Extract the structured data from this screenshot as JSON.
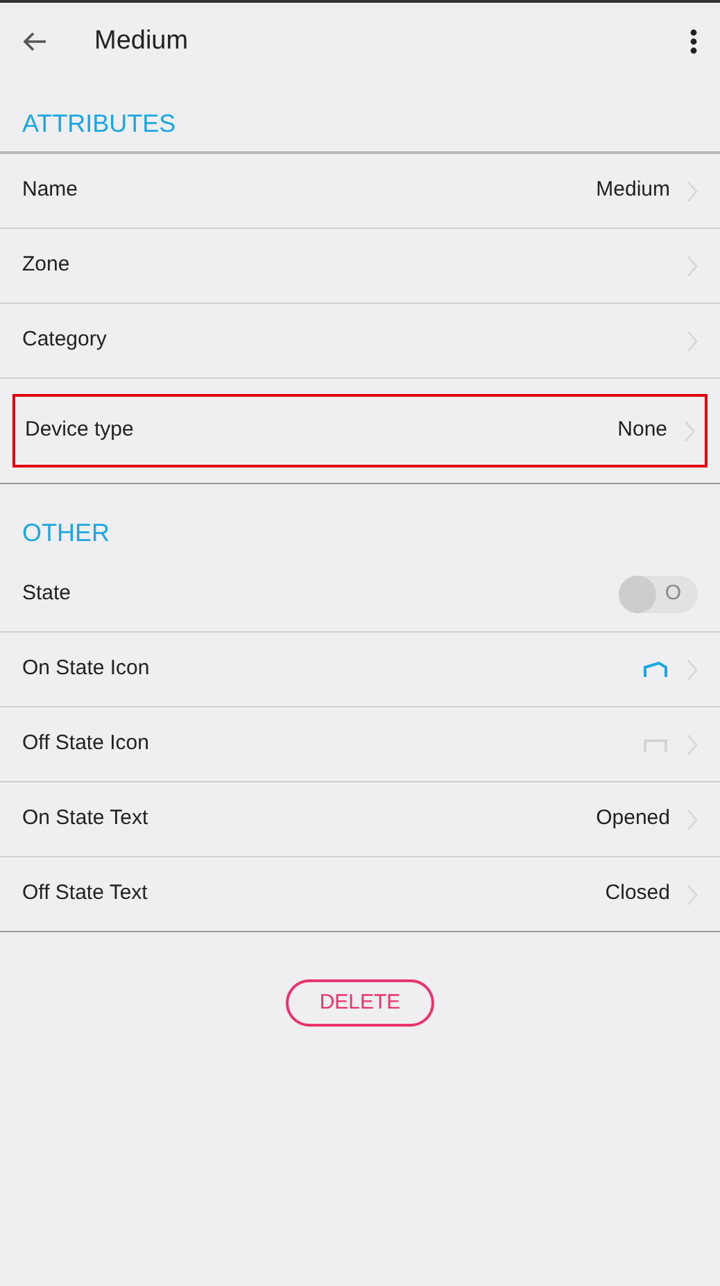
{
  "app_bar": {
    "title": "Medium"
  },
  "sections": [
    {
      "title": "ATTRIBUTES",
      "rows": [
        {
          "kind": "text",
          "label": "Name",
          "value": "Medium",
          "highlighted": false
        },
        {
          "kind": "text",
          "label": "Zone",
          "highlighted": false
        },
        {
          "kind": "text",
          "label": "Category",
          "highlighted": false
        },
        {
          "kind": "text",
          "label": "Device type",
          "value": "None",
          "highlighted": true
        }
      ]
    },
    {
      "title": "OTHER",
      "rows": [
        {
          "kind": "toggle",
          "label": "State",
          "on": false,
          "toggle_text": "O",
          "highlighted": false
        },
        {
          "kind": "open_icon",
          "label": "On State Icon",
          "highlighted": false
        },
        {
          "kind": "closed_icon",
          "label": "Off State Icon",
          "highlighted": false
        },
        {
          "kind": "text",
          "label": "On State Text",
          "value": "Opened",
          "highlighted": false
        },
        {
          "kind": "text",
          "label": "Off State Text",
          "value": "Closed",
          "highlighted": false
        }
      ]
    }
  ],
  "delete_button": "DELETE"
}
